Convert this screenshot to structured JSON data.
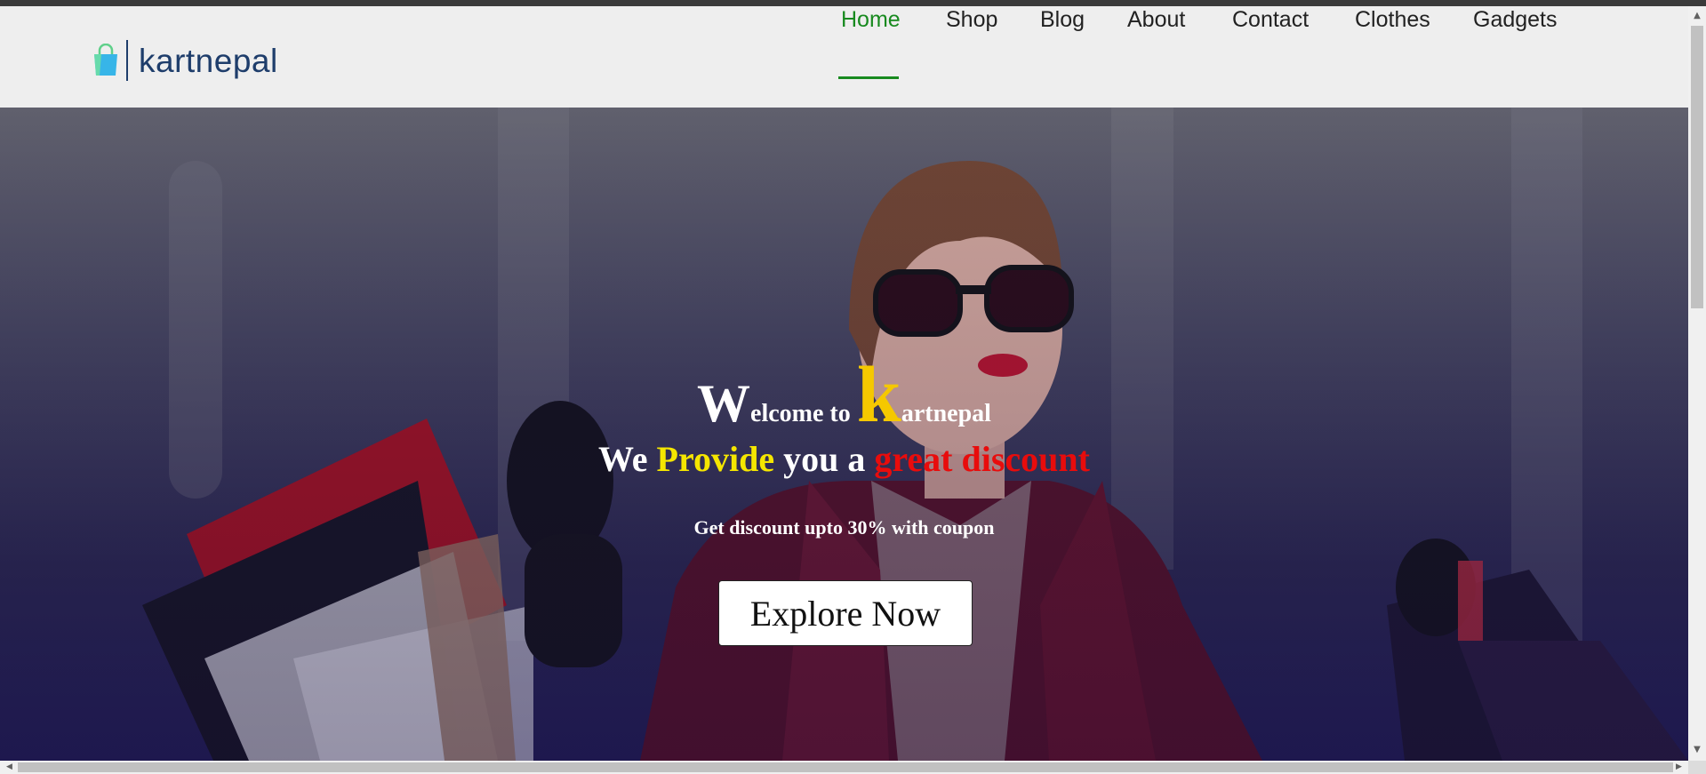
{
  "brand": {
    "name": "kartnepal",
    "logo_icon": "shopping-bag-icon"
  },
  "nav": {
    "items": [
      {
        "label": "Home",
        "active": true
      },
      {
        "label": "Shop",
        "active": false
      },
      {
        "label": "Blog",
        "active": false
      },
      {
        "label": "About",
        "active": false
      },
      {
        "label": "Contact",
        "active": false
      },
      {
        "label": "Clothes",
        "active": false
      },
      {
        "label": "Gadgets",
        "active": false
      }
    ]
  },
  "hero": {
    "welcome": {
      "w": "W",
      "elcome_to": "elcome to ",
      "k": "k",
      "artnepal": "artnepal"
    },
    "tagline": {
      "we": "We ",
      "provide": "Provide",
      "you_a": " you a ",
      "great_discount": "great discount"
    },
    "discount_text": "Get discount upto 30% with coupon",
    "cta_label": "Explore Now"
  },
  "colors": {
    "accent_green": "#188a1f",
    "brand_blue": "#1e3d6b",
    "highlight_yellow": "#f5c800",
    "highlight_red": "#e80c0c"
  }
}
